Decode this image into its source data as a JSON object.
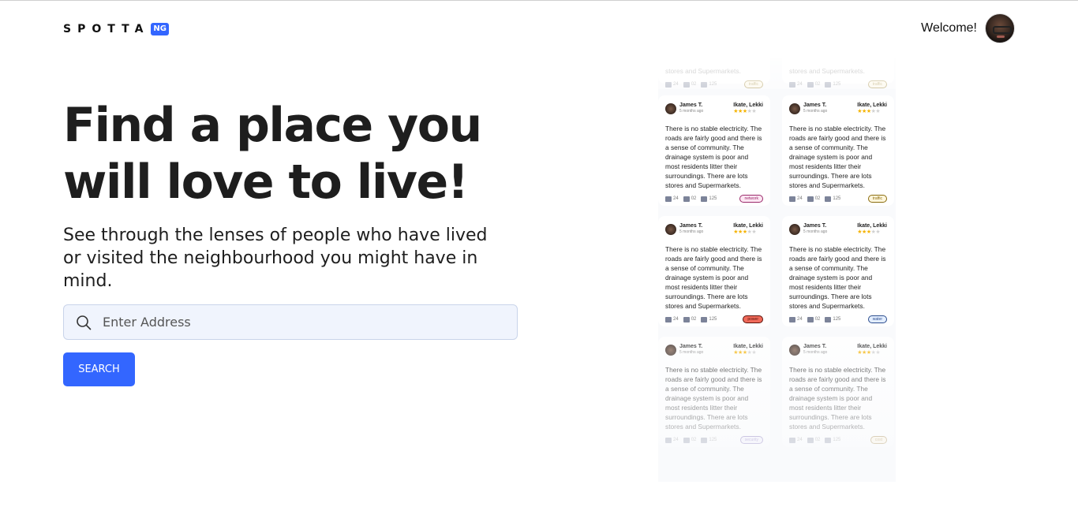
{
  "header": {
    "logo_text": "SPOTTA",
    "logo_badge": "NG",
    "welcome_text": "Welcome!"
  },
  "hero": {
    "title": "Find a place you will love to live!",
    "subtitle": "See through the lenses of people who have lived or visited the neighbourhood you might have in mind."
  },
  "search": {
    "placeholder": "Enter Address",
    "value": "",
    "button_label": "SEARCH"
  },
  "colors": {
    "brand": "#3366ff",
    "search_bg": "#f0f4fd",
    "star": "#f5b301"
  },
  "reviews": {
    "partial_top": [
      {
        "body_tail": "stores and Supermarkets.",
        "likes": "24",
        "dislikes": "02",
        "comments": "125",
        "tag": "traffic"
      },
      {
        "body_tail": "stores and Supermarkets.",
        "likes": "24",
        "dislikes": "02",
        "comments": "125",
        "tag": "traffic"
      }
    ],
    "cards": [
      {
        "user": "James T.",
        "time": "5 months ago",
        "location": "Ikate, Lekki",
        "rating": 3,
        "body": "There is no stable electricity. The roads are fairly good and there is a sense of community. The drainage system is poor and most residents litter their surroundings. There are lots stores and Supermarkets.",
        "likes": "24",
        "dislikes": "02",
        "comments": "125",
        "tag": "network"
      },
      {
        "user": "James T.",
        "time": "5 months ago",
        "location": "Ikate, Lekki",
        "rating": 3,
        "body": "There is no stable electricity. The roads are fairly good and there is a sense of community. The drainage system is poor and most residents litter their surroundings. There are lots stores and Supermarkets.",
        "likes": "24",
        "dislikes": "02",
        "comments": "125",
        "tag": "traffic"
      },
      {
        "user": "James T.",
        "time": "5 months ago",
        "location": "Ikate, Lekki",
        "rating": 3,
        "body": "There is no stable electricity. The roads are fairly good and there is a sense of community. The drainage system is poor and most residents litter their surroundings. There are lots stores and Supermarkets.",
        "likes": "24",
        "dislikes": "02",
        "comments": "125",
        "tag": "power"
      },
      {
        "user": "James T.",
        "time": "5 months ago",
        "location": "Ikate, Lekki",
        "rating": 3,
        "body": "There is no stable electricity. The roads are fairly good and there is a sense of community. The drainage system is poor and most residents litter their surroundings. There are lots stores and Supermarkets.",
        "likes": "24",
        "dislikes": "02",
        "comments": "125",
        "tag": "water"
      },
      {
        "user": "James T.",
        "time": "5 months ago",
        "location": "Ikate, Lekki",
        "rating": 3,
        "body": "There is no stable electricity. The roads are fairly good and there is a sense of community. The drainage system is poor and most residents litter their surroundings. There are lots stores and Supermarkets.",
        "likes": "24",
        "dislikes": "02",
        "comments": "125",
        "tag": "security"
      },
      {
        "user": "James T.",
        "time": "5 months ago",
        "location": "Ikate, Lekki",
        "rating": 3,
        "body": "There is no stable electricity. The roads are fairly good and there is a sense of community. The drainage system is poor and most residents litter their surroundings. There are lots stores and Supermarkets.",
        "likes": "24",
        "dislikes": "02",
        "comments": "125",
        "tag": "cost"
      }
    ]
  }
}
